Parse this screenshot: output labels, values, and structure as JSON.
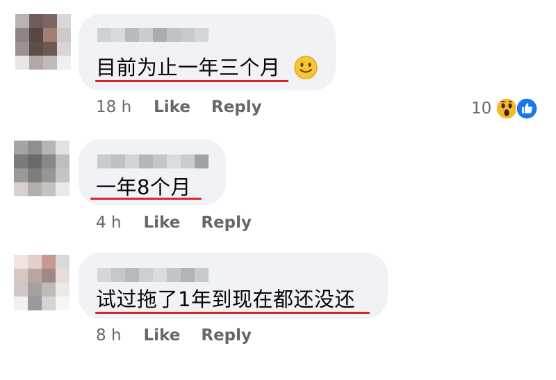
{
  "comments": [
    {
      "text": "目前为止一年三个月",
      "time": "18 h",
      "like_label": "Like",
      "reply_label": "Reply",
      "reaction_count": "10"
    },
    {
      "text": "一年8个月",
      "time": "4 h",
      "like_label": "Like",
      "reply_label": "Reply"
    },
    {
      "text": "试过拖了1年到现在都还没还",
      "time": "8 h",
      "like_label": "Like",
      "reply_label": "Reply"
    }
  ],
  "colors": {
    "bubble": "#f0f2f5",
    "meta_text": "#65676b",
    "underline": "#d8262b",
    "like_blue": "#1877f2",
    "reaction_yellow": "#f7b928"
  },
  "icons": {
    "smile": "slightly-smiling-face-icon",
    "wow": "wow-reaction-icon",
    "like": "thumbs-up-reaction-icon"
  }
}
